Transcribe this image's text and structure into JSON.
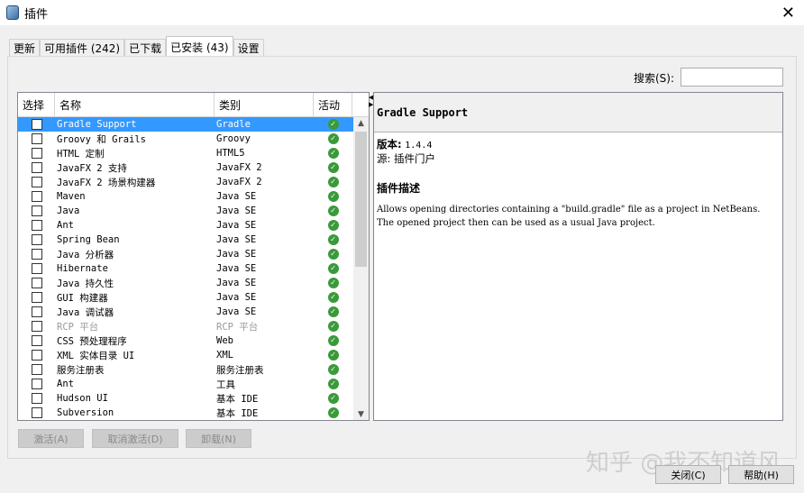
{
  "window": {
    "title": "插件"
  },
  "tabs": [
    {
      "label": "更新"
    },
    {
      "label": "可用插件 (242)"
    },
    {
      "label": "已下载"
    },
    {
      "label": "已安装 (43)"
    },
    {
      "label": "设置"
    }
  ],
  "search": {
    "label": "搜索(S):",
    "value": ""
  },
  "table": {
    "headers": [
      "选择",
      "名称",
      "类别",
      "活动"
    ],
    "rows": [
      {
        "name": "Gradle Support",
        "category": "Gradle"
      },
      {
        "name": "Groovy 和 Grails",
        "category": "Groovy"
      },
      {
        "name": "HTML 定制",
        "category": "HTML5"
      },
      {
        "name": "JavaFX 2 支持",
        "category": "JavaFX 2"
      },
      {
        "name": "JavaFX 2 场景构建器",
        "category": "JavaFX 2"
      },
      {
        "name": "Maven",
        "category": "Java SE"
      },
      {
        "name": "Java",
        "category": "Java SE"
      },
      {
        "name": "Ant",
        "category": "Java SE"
      },
      {
        "name": "Spring Bean",
        "category": "Java SE"
      },
      {
        "name": "Java 分析器",
        "category": "Java SE"
      },
      {
        "name": "Hibernate",
        "category": "Java SE"
      },
      {
        "name": "Java 持久性",
        "category": "Java SE"
      },
      {
        "name": "GUI 构建器",
        "category": "Java SE"
      },
      {
        "name": "Java 调试器",
        "category": "Java SE"
      },
      {
        "name": "RCP 平台",
        "category": "RCP 平台"
      },
      {
        "name": "CSS 预处理程序",
        "category": "Web"
      },
      {
        "name": "XML 实体目录 UI",
        "category": "XML"
      },
      {
        "name": "服务注册表",
        "category": "服务注册表"
      },
      {
        "name": "Ant",
        "category": "工具"
      },
      {
        "name": "Hudson UI",
        "category": "基本 IDE"
      },
      {
        "name": "Subversion",
        "category": "基本 IDE"
      }
    ]
  },
  "detail": {
    "title": "Gradle Support",
    "version_label": "版本:",
    "version": "1.4.4",
    "source_label": "源:",
    "source": "插件门户",
    "desc_heading": "插件描述",
    "description": "Allows opening directories containing a \"build.gradle\" file as a project in NetBeans. The opened project then can be used as a usual Java project."
  },
  "buttons": {
    "activate": "激活(A)",
    "deactivate": "取消激活(D)",
    "uninstall": "卸载(N)",
    "close": "关闭(C)",
    "help": "帮助(H)"
  },
  "watermark": "知乎 @我不知道风"
}
